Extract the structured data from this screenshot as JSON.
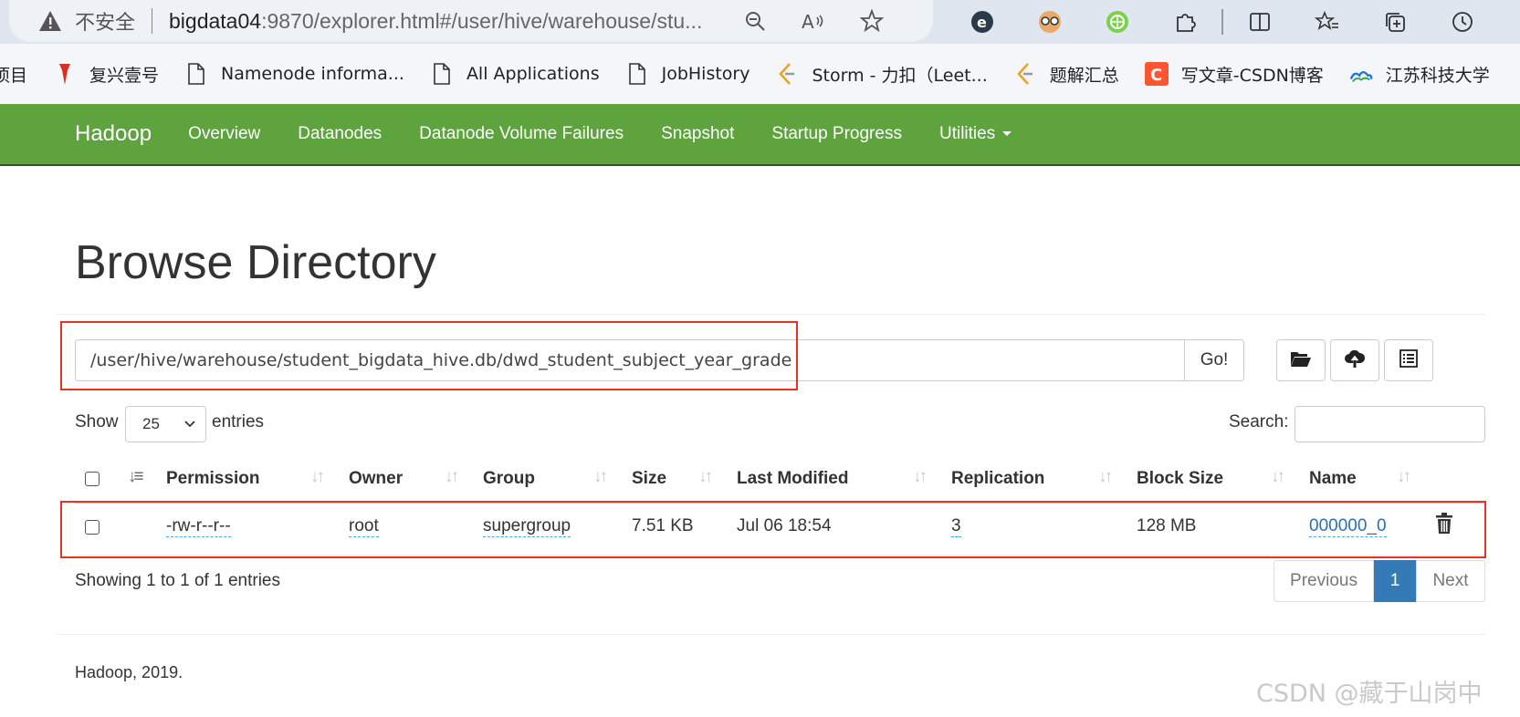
{
  "browser": {
    "insecure_label": "不安全",
    "url_host": "bigdata04",
    "url_rest": ":9870/explorer.html#/user/hive/warehouse/stu...",
    "bookmarks": [
      {
        "label": "项目",
        "icon": "folder-icon"
      },
      {
        "label": "复兴壹号",
        "icon": "pin-icon"
      },
      {
        "label": "Namenode informa...",
        "icon": "page-icon"
      },
      {
        "label": "All Applications",
        "icon": "page-icon"
      },
      {
        "label": "JobHistory",
        "icon": "page-icon"
      },
      {
        "label": "Storm - 力扣（Leet...",
        "icon": "leetcode-icon"
      },
      {
        "label": "题解汇总",
        "icon": "leetcode-icon"
      },
      {
        "label": "写文章-CSDN博客",
        "icon": "csdn-icon"
      },
      {
        "label": "江苏科技大学",
        "icon": "cloud-icon"
      }
    ]
  },
  "navbar": {
    "brand": "Hadoop",
    "items": [
      "Overview",
      "Datanodes",
      "Datanode Volume Failures",
      "Snapshot",
      "Startup Progress",
      "Utilities"
    ]
  },
  "page": {
    "title": "Browse Directory",
    "path": "/user/hive/warehouse/student_bigdata_hive.db/dwd_student_subject_year_grade",
    "go_label": "Go!",
    "show_label": "Show",
    "entries_value": "25",
    "entries_label": "entries",
    "search_label": "Search:",
    "search_value": ""
  },
  "table": {
    "columns": [
      "Permission",
      "Owner",
      "Group",
      "Size",
      "Last Modified",
      "Replication",
      "Block Size",
      "Name"
    ],
    "rows": [
      {
        "permission": "-rw-r--r--",
        "owner": "root",
        "group": "supergroup",
        "size": "7.51 KB",
        "last_modified": "Jul 06 18:54",
        "replication": "3",
        "block_size": "128 MB",
        "name": "000000_0"
      }
    ]
  },
  "pagination": {
    "info": "Showing 1 to 1 of 1 entries",
    "previous": "Previous",
    "current": "1",
    "next": "Next"
  },
  "footer": "Hadoop, 2019.",
  "watermark": "CSDN @藏于山岗中",
  "colors": {
    "navbar": "#5fa33e",
    "highlight_box": "#e8321f",
    "link": "#2a6fb0",
    "active_page": "#337ab7"
  }
}
